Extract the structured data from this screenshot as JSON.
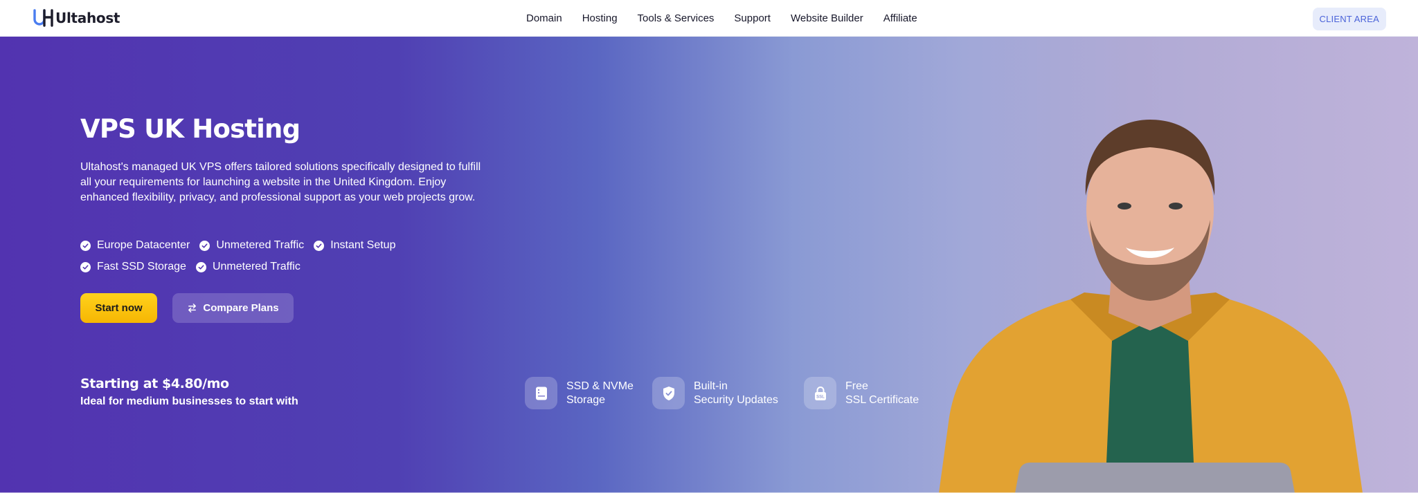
{
  "brand": {
    "name": "Ultahost",
    "colors": {
      "primary": "#5233b0",
      "accent_yellow": "#f9c20d",
      "client_btn_text": "#4b63d9",
      "client_btn_bg": "#e7ecfb"
    }
  },
  "nav": {
    "items": [
      "Domain",
      "Hosting",
      "Tools & Services",
      "Support",
      "Website Builder",
      "Affiliate"
    ],
    "client_area": "CLIENT AREA"
  },
  "hero": {
    "title": "VPS UK Hosting",
    "description": "Ultahost's managed UK VPS offers tailored solutions specifically designed to fulfill all your requirements for launching a website in the United Kingdom. Enjoy enhanced flexibility, privacy, and professional support as your web projects grow.",
    "features": [
      [
        "Europe Datacenter",
        "Unmetered Traffic",
        "Instant Setup"
      ],
      [
        "Fast SSD Storage",
        "Unmetered Traffic"
      ]
    ],
    "buttons": {
      "start": "Start now",
      "compare": "Compare Plans"
    },
    "price": "Starting at $4.80/mo",
    "price_sub": "Ideal for medium businesses to start with",
    "badges": [
      {
        "icon": "server-icon",
        "line1": "SSD & NVMe",
        "line2": "Storage"
      },
      {
        "icon": "shield-check-icon",
        "line1": "Built-in",
        "line2": "Security Updates"
      },
      {
        "icon": "lock-ssl-icon",
        "line1": "Free",
        "line2": "SSL Certificate",
        "icon_text": "SSL"
      }
    ]
  }
}
